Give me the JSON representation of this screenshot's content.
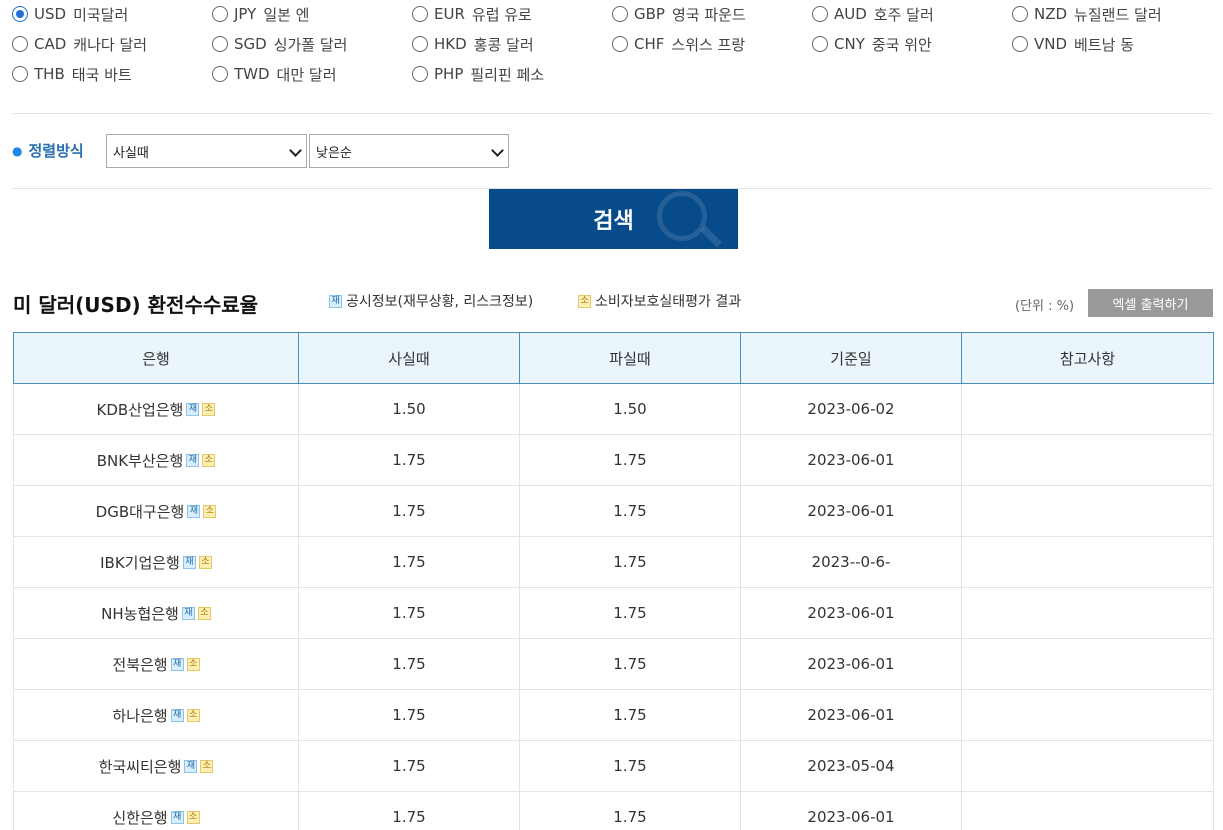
{
  "currencies": [
    [
      {
        "code": "USD",
        "name": "미국달러",
        "checked": true
      },
      {
        "code": "JPY",
        "name": "일본 엔",
        "checked": false
      },
      {
        "code": "EUR",
        "name": "유럽 유로",
        "checked": false
      },
      {
        "code": "GBP",
        "name": "영국 파운드",
        "checked": false
      },
      {
        "code": "AUD",
        "name": "호주 달러",
        "checked": false
      },
      {
        "code": "NZD",
        "name": "뉴질랜드 달러",
        "checked": false
      }
    ],
    [
      {
        "code": "CAD",
        "name": "캐나다 달러",
        "checked": false
      },
      {
        "code": "SGD",
        "name": "싱가폴 달러",
        "checked": false
      },
      {
        "code": "HKD",
        "name": "홍콩 달러",
        "checked": false
      },
      {
        "code": "CHF",
        "name": "스위스 프랑",
        "checked": false
      },
      {
        "code": "CNY",
        "name": "중국 위안",
        "checked": false
      },
      {
        "code": "VND",
        "name": "베트남 동",
        "checked": false
      }
    ],
    [
      {
        "code": "THB",
        "name": "태국 바트",
        "checked": false
      },
      {
        "code": "TWD",
        "name": "대만 달러",
        "checked": false
      },
      {
        "code": "PHP",
        "name": "필리핀 페소",
        "checked": false
      }
    ]
  ],
  "sort": {
    "label": "정렬방식",
    "field_value": "사실때",
    "order_value": "낮은순"
  },
  "search_button": "검색",
  "result": {
    "title": "미 달러(USD) 환전수수료율",
    "legend_jae_badge": "재",
    "legend_jae_text": "공시정보(재무상황, 리스크정보)",
    "legend_so_badge": "소",
    "legend_so_text": "소비자보호실태평가 결과",
    "unit": "(단위 : %)",
    "excel_button": "엑셀 출력하기"
  },
  "table": {
    "headers": [
      "은행",
      "사실때",
      "파실때",
      "기준일",
      "참고사항"
    ],
    "badge_jae": "재",
    "badge_so": "소",
    "rows": [
      {
        "bank": "KDB산업은행",
        "buy": "1.50",
        "sell": "1.50",
        "date": "2023-06-02",
        "note": ""
      },
      {
        "bank": "BNK부산은행",
        "buy": "1.75",
        "sell": "1.75",
        "date": "2023-06-01",
        "note": ""
      },
      {
        "bank": "DGB대구은행",
        "buy": "1.75",
        "sell": "1.75",
        "date": "2023-06-01",
        "note": ""
      },
      {
        "bank": "IBK기업은행",
        "buy": "1.75",
        "sell": "1.75",
        "date": "2023--0-6-",
        "note": ""
      },
      {
        "bank": "NH농협은행",
        "buy": "1.75",
        "sell": "1.75",
        "date": "2023-06-01",
        "note": ""
      },
      {
        "bank": "전북은행",
        "buy": "1.75",
        "sell": "1.75",
        "date": "2023-06-01",
        "note": ""
      },
      {
        "bank": "하나은행",
        "buy": "1.75",
        "sell": "1.75",
        "date": "2023-06-01",
        "note": ""
      },
      {
        "bank": "한국씨티은행",
        "buy": "1.75",
        "sell": "1.75",
        "date": "2023-05-04",
        "note": ""
      },
      {
        "bank": "신한은행",
        "buy": "1.75",
        "sell": "1.75",
        "date": "2023-06-01",
        "note": ""
      }
    ]
  }
}
